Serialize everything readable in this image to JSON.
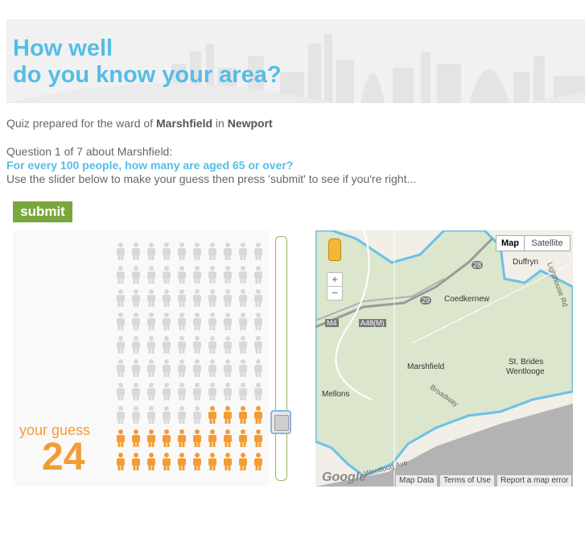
{
  "header": {
    "title_line1": "How well",
    "title_line2": "do you know your area?"
  },
  "intro": {
    "prefix": "Quiz prepared for the ward of ",
    "ward": "Marshfield",
    "middle": " in ",
    "area": "Newport"
  },
  "question": {
    "counter": "Question 1 of 7 about Marshfield:",
    "text": "For every 100 people, how many are aged 65 or over?",
    "instructions": "Use the slider below to make your guess then press 'submit' to see if you're right..."
  },
  "submit_label": "submit",
  "guess": {
    "label": "your guess",
    "value": "24",
    "fraction": 0.24,
    "total": 100
  },
  "colors": {
    "accent_blue": "#55bde6",
    "submit_green": "#79a83d",
    "guess_orange": "#f39c34",
    "person_grey": "#d8d8d8",
    "ward_fill": "#dbe6cc",
    "ward_border": "#6cc0e8"
  },
  "map": {
    "type_map": "Map",
    "type_satellite": "Satellite",
    "zoom_in": "+",
    "zoom_out": "−",
    "places": {
      "duffryn": "Duffryn",
      "coedkernew": "Coedkernew",
      "marshfield": "Marshfield",
      "st_brides": "St. Brides",
      "wentlooge": "Wentlooge",
      "mellons": "Mellons",
      "broadway": "Broadway",
      "lighthouse_rd": "Lighthouse Rd",
      "wentloog_ave": "Wentloog Ave"
    },
    "roads": {
      "m4": "M4",
      "a48m": "A48(M)",
      "j28": "28",
      "j29": "29"
    },
    "logo": "Google",
    "links": {
      "map_data": "Map Data",
      "terms": "Terms of Use",
      "report": "Report a map error"
    }
  }
}
